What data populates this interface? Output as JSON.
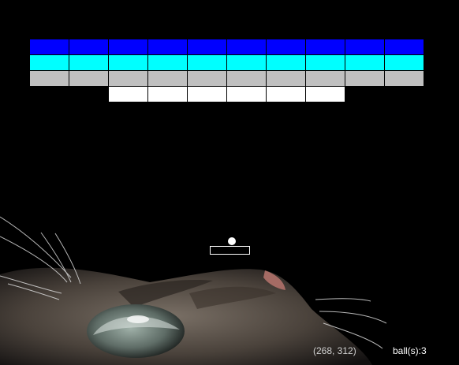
{
  "colors": {
    "background": "#000000",
    "rows": [
      "#0000ff",
      "#00ffff",
      "#c0c0c0",
      "#ffffff"
    ]
  },
  "bricks": {
    "rows": [
      [
        1,
        1,
        1,
        1,
        1,
        1,
        1,
        1,
        1,
        1
      ],
      [
        1,
        1,
        1,
        1,
        1,
        1,
        1,
        1,
        1,
        1
      ],
      [
        1,
        1,
        1,
        1,
        1,
        1,
        1,
        1,
        1,
        1
      ],
      [
        0,
        0,
        1,
        1,
        1,
        1,
        1,
        1,
        0,
        0
      ]
    ]
  },
  "hud": {
    "coords": "(268, 312)",
    "balls": "ball(s):3"
  }
}
